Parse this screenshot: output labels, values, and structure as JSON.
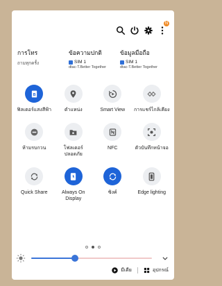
{
  "top_icons": {
    "search": "search-icon",
    "power": "power-icon",
    "settings": "gear-icon",
    "more": "more-vertical-icon",
    "badge": "N"
  },
  "sims": [
    {
      "title": "การโทร",
      "sub": "ถามทุกครั้ง",
      "sim": "",
      "operator": ""
    },
    {
      "title": "ข้อความปกติ",
      "sub": "",
      "sim": "SIM 1",
      "operator": "dtac-T.Better Together"
    },
    {
      "title": "ข้อมูลมือถือ",
      "sub": "",
      "sim": "SIM 1",
      "operator": "dtac-T.Better Together"
    }
  ],
  "tiles": [
    {
      "label": "ฟิลเตอร์แสงสีฟ้า",
      "icon": "blue-light-filter-icon",
      "on": true
    },
    {
      "label": "ตำแหน่ง",
      "icon": "location-icon",
      "on": false
    },
    {
      "label": "Smart View",
      "icon": "smart-view-icon",
      "on": false
    },
    {
      "label": "การแชร์ไกล้เคียง",
      "icon": "nearby-share-icon",
      "on": false
    },
    {
      "label": "ห้ามรบกวน",
      "icon": "do-not-disturb-icon",
      "on": false
    },
    {
      "label": "โฟลเดอร์ปลอดภัย",
      "icon": "secure-folder-icon",
      "on": false
    },
    {
      "label": "NFC",
      "icon": "nfc-icon",
      "on": false
    },
    {
      "label": "ตัวบันทึกหน้าจอ",
      "icon": "screen-recorder-icon",
      "on": false
    },
    {
      "label": "Quick Share",
      "icon": "quick-share-icon",
      "on": false
    },
    {
      "label": "Always On Display",
      "icon": "always-on-display-icon",
      "on": true
    },
    {
      "label": "ซิงค์",
      "icon": "sync-icon",
      "on": true
    },
    {
      "label": "Edge lighting",
      "icon": "edge-lighting-icon",
      "on": false
    }
  ],
  "page_indicator": {
    "count": 3,
    "active": 1
  },
  "brightness": {
    "level": 0.36
  },
  "bottom": {
    "media_label": "มีเดีย",
    "devices_label": "อุปกรณ์"
  },
  "colors": {
    "accent": "#1e64d8",
    "background": "#c9b497"
  }
}
